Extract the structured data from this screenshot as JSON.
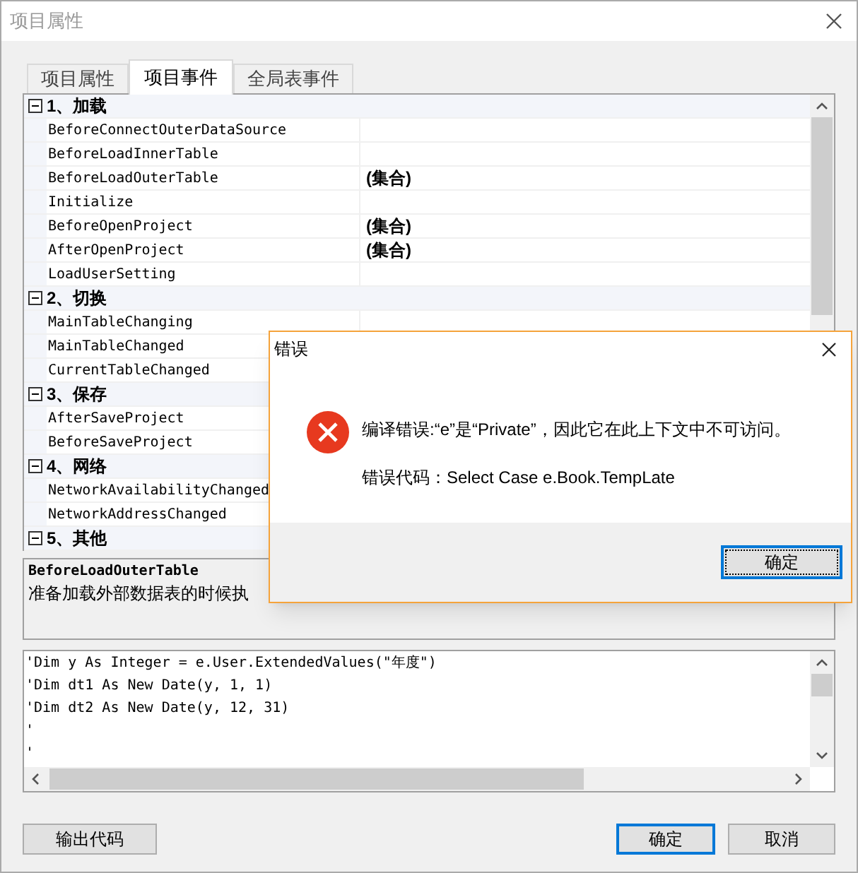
{
  "window": {
    "title": "项目属性"
  },
  "tabs": [
    {
      "label": "项目属性",
      "selected": false
    },
    {
      "label": "项目事件",
      "selected": true
    },
    {
      "label": "全局表事件",
      "selected": false
    }
  ],
  "property_grid": {
    "categories": [
      {
        "label": "1、加载",
        "expanded": true,
        "items": [
          {
            "name": "BeforeConnectOuterDataSource",
            "value": ""
          },
          {
            "name": "BeforeLoadInnerTable",
            "value": ""
          },
          {
            "name": "BeforeLoadOuterTable",
            "value": "(集合)"
          },
          {
            "name": "Initialize",
            "value": ""
          },
          {
            "name": "BeforeOpenProject",
            "value": "(集合)"
          },
          {
            "name": "AfterOpenProject",
            "value": "(集合)"
          },
          {
            "name": "LoadUserSetting",
            "value": ""
          }
        ]
      },
      {
        "label": "2、切换",
        "expanded": true,
        "items": [
          {
            "name": "MainTableChanging",
            "value": ""
          },
          {
            "name": "MainTableChanged"
          },
          {
            "name": "CurrentTableChanged"
          }
        ]
      },
      {
        "label": "3、保存",
        "expanded": true,
        "items": [
          {
            "name": "AfterSaveProject"
          },
          {
            "name": "BeforeSaveProject"
          }
        ]
      },
      {
        "label": "4、网络",
        "expanded": true,
        "items": [
          {
            "name": "NetworkAvailabilityChanged"
          },
          {
            "name": "NetworkAddressChanged"
          }
        ]
      },
      {
        "label": "5、其他",
        "expanded": true
      }
    ]
  },
  "description": {
    "title": "BeforeLoadOuterTable",
    "text": "准备加载外部数据表的时候执"
  },
  "code_editor": {
    "lines": [
      "'Dim y As Integer = e.User.ExtendedValues(\"年度\")",
      "'Dim dt1 As New Date(y, 1, 1)",
      "'Dim dt2 As New Date(y, 12, 31)",
      "'",
      "'"
    ]
  },
  "buttons": [
    {
      "label": "输出代码",
      "default": false
    },
    {
      "label": "确定",
      "default": true
    },
    {
      "label": "取消",
      "default": false
    }
  ],
  "error_dialog": {
    "title": "错误",
    "message": "编译错误:“e”是“Private”，因此它在此上下文中不可访问。",
    "code": "错误代码：Select Case e.Book.TempLate",
    "button": "确定"
  }
}
